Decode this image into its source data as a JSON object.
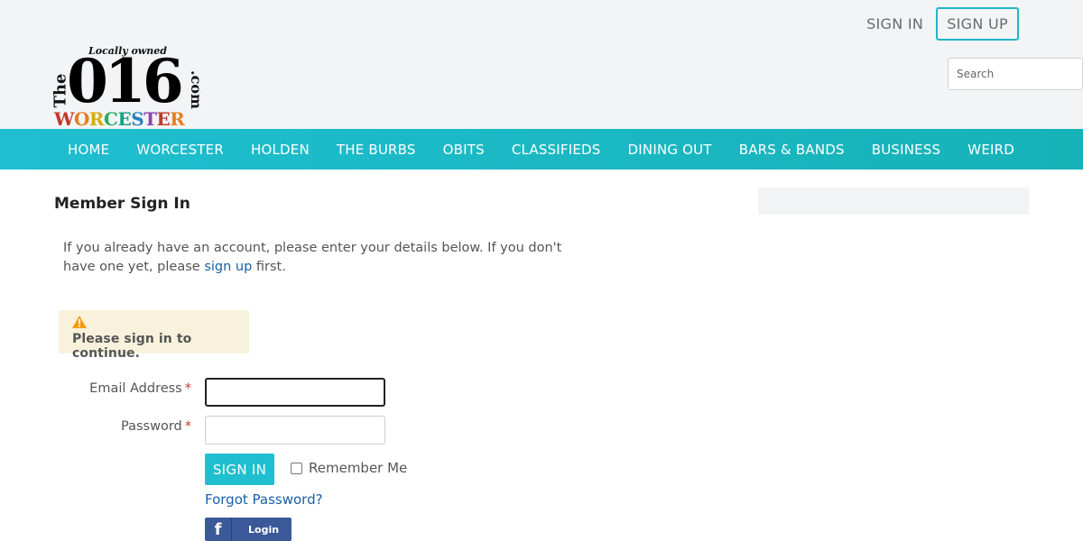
{
  "header": {
    "sign_in": "SIGN IN",
    "sign_up": "SIGN UP",
    "search_placeholder": "Search"
  },
  "logo": {
    "tagline": "Locally owned",
    "the": "The",
    "number": "016",
    "dotcom": ".com",
    "city_letters": [
      "W",
      "O",
      "R",
      "C",
      "E",
      "S",
      "T",
      "E",
      "R"
    ]
  },
  "nav": {
    "items": [
      "HOME",
      "WORCESTER",
      "HOLDEN",
      "THE BURBS",
      "OBITS",
      "CLASSIFIEDS",
      "DINING OUT",
      "BARS & BANDS",
      "BUSINESS",
      "WEIRD"
    ]
  },
  "main": {
    "title": "Member Sign In",
    "intro_before": "If you already have an account, please enter your details below. If you don't have one yet, please ",
    "intro_link": "sign up",
    "intro_after": " first.",
    "alert": "Please sign in to continue.",
    "email_label": "Email Address",
    "password_label": "Password",
    "required_mark": "*",
    "email_value": "",
    "password_value": "",
    "sign_in_button": "SIGN IN",
    "remember_label": "Remember Me",
    "remember_checked": false,
    "forgot_link": "Forgot Password?",
    "facebook_icon_glyph": "f",
    "facebook_label": "Login"
  },
  "colors": {
    "accent": "#1fbfd0",
    "link": "#1a5fa8",
    "required": "#d32f2f",
    "alert_bg": "#f8f1dc",
    "alert_icon": "#f39c12",
    "facebook": "#3b5998"
  }
}
